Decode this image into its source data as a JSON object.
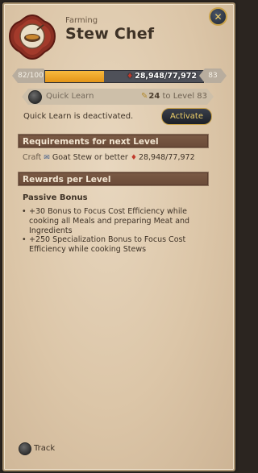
{
  "header": {
    "category": "Farming",
    "title": "Stew Chef",
    "close_icon": "close-icon"
  },
  "progress": {
    "current_level": "82/100",
    "next_level": "83",
    "fame_text": "28,948/77,972",
    "fame_fraction": 0.371,
    "fill_color": "#f0a52a"
  },
  "quick_learn": {
    "label": "Quick Learn",
    "target_value": "24",
    "target_text": "to Level 83",
    "status": "Quick Learn is deactivated.",
    "activate_label": "Activate"
  },
  "requirements": {
    "header": "Requirements for next Level",
    "craft_label": "Craft",
    "item": "Goat Stew or better",
    "fame": "28,948/77,972"
  },
  "rewards": {
    "header": "Rewards per Level",
    "passive_title": "Passive Bonus",
    "bonuses": [
      "+30 Bonus to Focus Cost Efficiency while cooking all Meals and preparing Meat and Ingredients",
      "+250 Specialization Bonus to Focus Cost Efficiency while cooking Stews"
    ]
  },
  "footer": {
    "track_label": "Track"
  },
  "colors": {
    "panel": "#dcc6a8",
    "section_header": "#735340",
    "accent_gold": "#c9a24a",
    "bar_fill": "#f0a52a"
  }
}
